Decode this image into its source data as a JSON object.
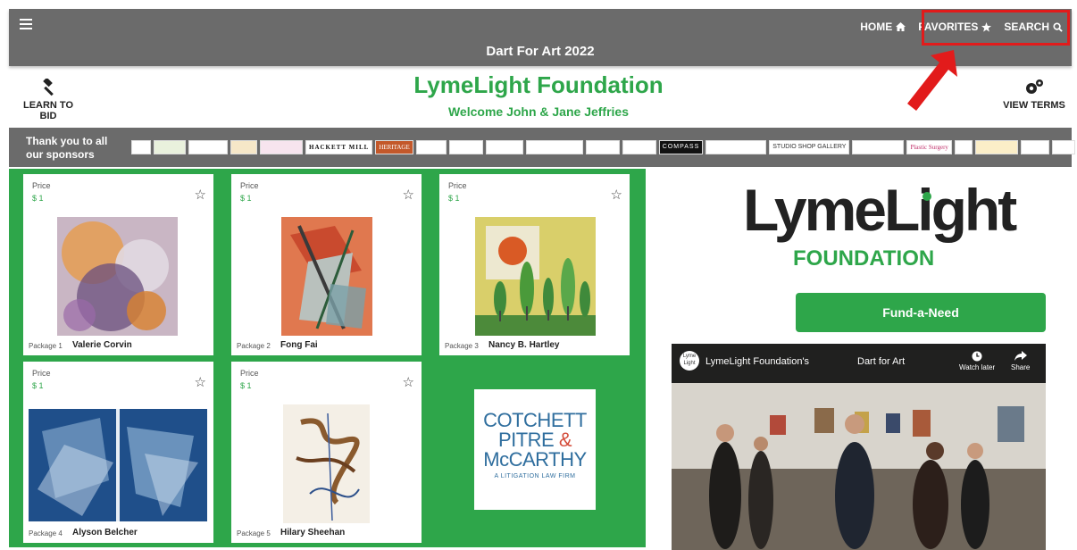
{
  "header": {
    "event_title": "Dart For Art 2022",
    "nav": [
      {
        "label": "HOME",
        "icon": "home-icon"
      },
      {
        "label": "FAVORITES",
        "icon": "star-icon"
      },
      {
        "label": "SEARCH",
        "icon": "search-icon"
      }
    ]
  },
  "actions": {
    "learn_to_bid": "LEARN TO BID",
    "view_terms": "VIEW TERMS"
  },
  "org": {
    "title": "LymeLight Foundation",
    "welcome": "Welcome John & Jane Jeffries"
  },
  "sponsors": {
    "label_line1": "Thank you to all",
    "label_line2": "our sponsors",
    "items": [
      "HACKETT MILL",
      "HERITAGE",
      "COMPASS",
      "STUDIO SHOP GALLERY",
      "Plastic Surgery"
    ]
  },
  "items": [
    {
      "price_label": "Price",
      "price": "$ 1",
      "package": "Package 1",
      "artist": "Valerie Corvin"
    },
    {
      "price_label": "Price",
      "price": "$ 1",
      "package": "Package 2",
      "artist": "Fong Fai"
    },
    {
      "price_label": "Price",
      "price": "$ 1",
      "package": "Package 3",
      "artist": "Nancy B. Hartley"
    },
    {
      "price_label": "Price",
      "price": "$ 1",
      "package": "Package 4",
      "artist": "Alyson Belcher"
    },
    {
      "price_label": "Price",
      "price": "$ 1",
      "package": "Package 5",
      "artist": "Hilary Sheehan"
    }
  ],
  "sponsor_card": {
    "line1": "COTCHETT",
    "line2": "PITRE",
    "amp": "&",
    "line3": "McCARTHY",
    "sub": "A LITIGATION LAW FIRM"
  },
  "brand": {
    "word": "LymeLight",
    "sub": "FOUNDATION"
  },
  "fund_button": "Fund-a-Need",
  "video": {
    "channel": "LymeLight Foundation's",
    "title": "Dart for Art",
    "watch_later": "Watch later",
    "share": "Share",
    "logo_text": "Lyme Light"
  },
  "colors": {
    "accent": "#2ea64a",
    "bar": "#6b6b6b",
    "highlight": "#e21b1b"
  }
}
